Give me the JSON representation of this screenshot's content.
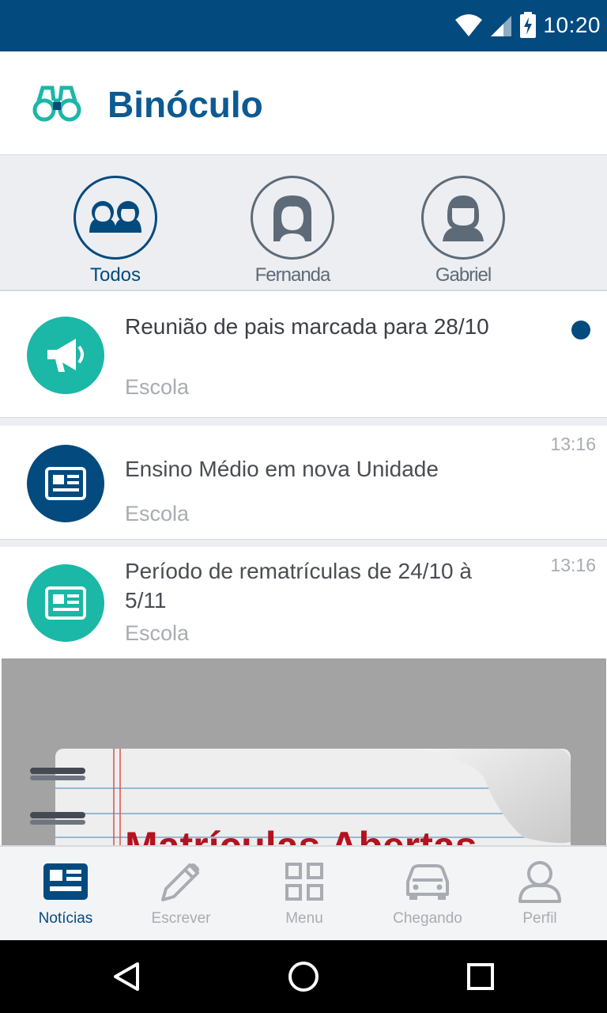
{
  "status_bar": {
    "time": "10:20"
  },
  "header": {
    "title": "Binóculo"
  },
  "filters": [
    {
      "label": "Todos",
      "icon": "group-icon",
      "active": true
    },
    {
      "label": "Fernanda",
      "icon": "girl-avatar-icon",
      "active": false
    },
    {
      "label": "Gabriel",
      "icon": "boy-avatar-icon",
      "active": false
    }
  ],
  "feed": [
    {
      "title": "Reunião de pais marcada para 28/10",
      "source": "Escola",
      "time": "",
      "icon": "megaphone-icon",
      "icon_color": "#1bb7a7",
      "unread": true
    },
    {
      "title": "Ensino Médio em nova Unidade",
      "source": "Escola",
      "time": "13:16",
      "icon": "newspaper-icon",
      "icon_color": "#034a7e",
      "unread": false
    },
    {
      "title": "Período de rematrículas de 24/10 à 5/11",
      "source": "Escola",
      "time": "13:16",
      "icon": "newspaper-icon",
      "icon_color": "#1bb7a7",
      "unread": false
    }
  ],
  "banner": {
    "text": "Matrículas Abertas"
  },
  "bottom_nav": [
    {
      "label": "Notícias",
      "icon": "news-icon",
      "active": true
    },
    {
      "label": "Escrever",
      "icon": "pencil-icon",
      "active": false
    },
    {
      "label": "Menu",
      "icon": "grid-icon",
      "active": false
    },
    {
      "label": "Chegando",
      "icon": "car-icon",
      "active": false
    },
    {
      "label": "Perfil",
      "icon": "user-icon",
      "active": false
    }
  ],
  "colors": {
    "primary": "#034a7e",
    "accent": "#1bb7a7",
    "muted": "#a8acb2"
  }
}
